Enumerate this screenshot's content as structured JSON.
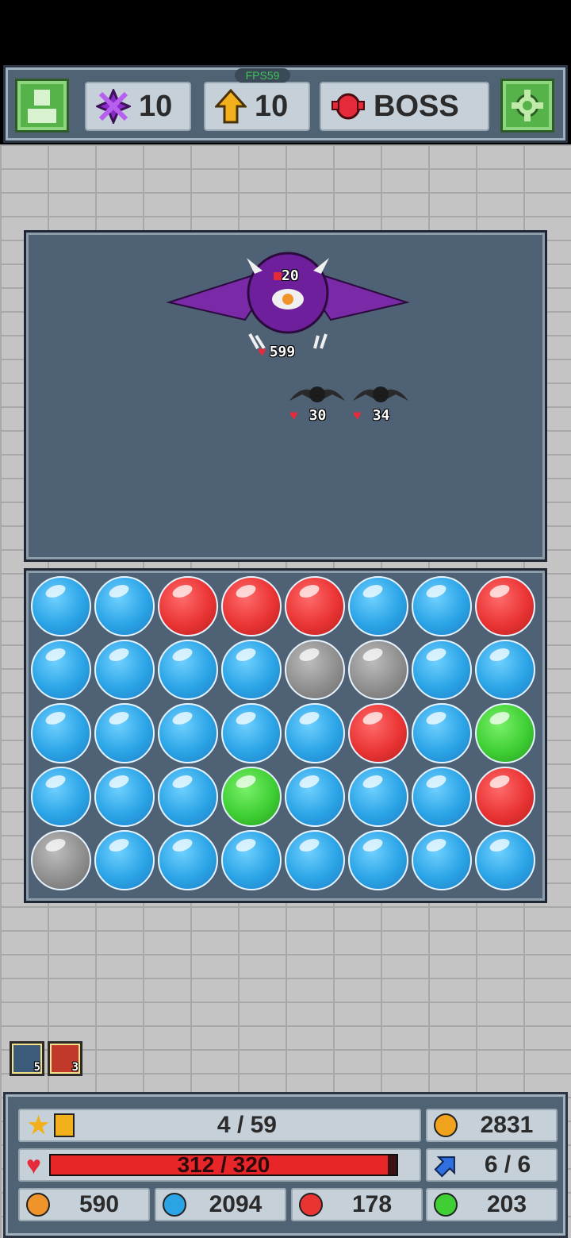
{
  "topbar": {
    "fps_label": "FPS59",
    "gems_count": "10",
    "arrows_count": "10",
    "stage_label": "BOSS"
  },
  "battle": {
    "boss": {
      "attack": "20",
      "hp": "599"
    },
    "bats": [
      {
        "hp": "30"
      },
      {
        "hp": "34"
      }
    ]
  },
  "board": {
    "rows": [
      [
        "blue",
        "blue",
        "red",
        "red",
        "red",
        "blue",
        "blue",
        "red"
      ],
      [
        "blue",
        "blue",
        "blue",
        "blue",
        "gray",
        "gray",
        "blue",
        "blue"
      ],
      [
        "blue",
        "blue",
        "blue",
        "blue",
        "blue",
        "red",
        "blue",
        "green"
      ],
      [
        "blue",
        "blue",
        "blue",
        "green",
        "blue",
        "blue",
        "blue",
        "red"
      ],
      [
        "gray",
        "blue",
        "blue",
        "blue",
        "blue",
        "blue",
        "blue",
        "blue"
      ]
    ]
  },
  "buffs": [
    {
      "icon": "sword-buff-icon",
      "count": "5"
    },
    {
      "icon": "heart-buff-icon",
      "count": "3"
    }
  ],
  "stats": {
    "progress": "4 / 59",
    "coins": "2831",
    "hp_text": "312 / 320",
    "hp_fraction": 0.975,
    "moves": "6 / 6",
    "orange_count": "590",
    "blue_count": "2094",
    "red_count": "178",
    "green_count": "203"
  },
  "colors": {
    "blue": "#2ba4e6",
    "red": "#ea3434",
    "green": "#3fcf34",
    "gray": "#8f8f8f",
    "orange": "#f0932b",
    "hp_bar": "#e8262a"
  }
}
